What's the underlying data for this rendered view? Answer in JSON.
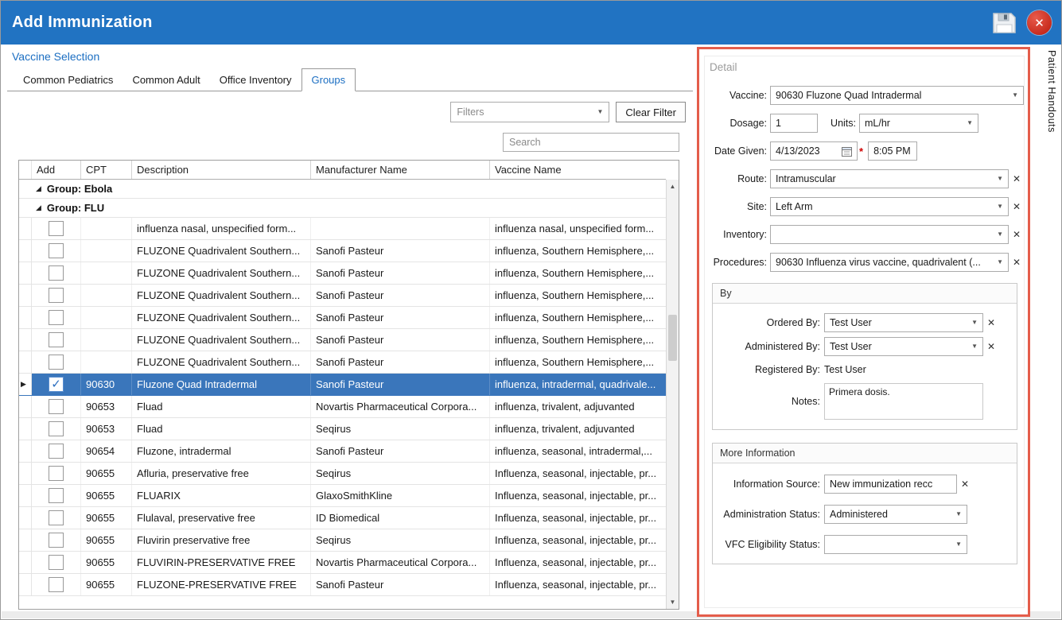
{
  "window": {
    "title": "Add Immunization"
  },
  "icons": {
    "dropdown": "▼",
    "clear": "✕",
    "close_window": "✕",
    "scroll_up": "▲",
    "scroll_down": "▼",
    "group_expander": "◢",
    "row_selector": "▶",
    "checkbox_check": "✓"
  },
  "side_tab_label": "Patient Handouts",
  "vaccine_selection": {
    "header": "Vaccine Selection",
    "tabs": [
      "Common Pediatrics",
      "Common Adult",
      "Office Inventory",
      "Groups"
    ],
    "active_tab": "Groups",
    "filters_placeholder": "Filters",
    "clear_filter_label": "Clear Filter",
    "search_placeholder": "Search",
    "grid": {
      "columns": [
        "Add",
        "CPT",
        "Description",
        "Manufacturer Name",
        "Vaccine Name"
      ],
      "groups": [
        {
          "label": "Group: Ebola",
          "rows": []
        },
        {
          "label": "Group: FLU",
          "rows": [
            {
              "checked": false,
              "selected": false,
              "cpt": "",
              "description": "influenza nasal, unspecified form...",
              "manufacturer": "",
              "vaccine_name": "influenza nasal, unspecified form..."
            },
            {
              "checked": false,
              "selected": false,
              "cpt": "",
              "description": "FLUZONE Quadrivalent Southern...",
              "manufacturer": "Sanofi Pasteur",
              "vaccine_name": "influenza, Southern Hemisphere,..."
            },
            {
              "checked": false,
              "selected": false,
              "cpt": "",
              "description": "FLUZONE Quadrivalent Southern...",
              "manufacturer": "Sanofi Pasteur",
              "vaccine_name": "influenza, Southern Hemisphere,..."
            },
            {
              "checked": false,
              "selected": false,
              "cpt": "",
              "description": "FLUZONE Quadrivalent Southern...",
              "manufacturer": "Sanofi Pasteur",
              "vaccine_name": "influenza, Southern Hemisphere,..."
            },
            {
              "checked": false,
              "selected": false,
              "cpt": "",
              "description": "FLUZONE Quadrivalent Southern...",
              "manufacturer": "Sanofi Pasteur",
              "vaccine_name": "influenza, Southern Hemisphere,..."
            },
            {
              "checked": false,
              "selected": false,
              "cpt": "",
              "description": "FLUZONE Quadrivalent Southern...",
              "manufacturer": "Sanofi Pasteur",
              "vaccine_name": "influenza, Southern Hemisphere,..."
            },
            {
              "checked": false,
              "selected": false,
              "cpt": "",
              "description": "FLUZONE Quadrivalent Southern...",
              "manufacturer": "Sanofi Pasteur",
              "vaccine_name": "influenza, Southern Hemisphere,..."
            },
            {
              "checked": true,
              "selected": true,
              "cpt": "90630",
              "description": "Fluzone Quad Intradermal",
              "manufacturer": "Sanofi Pasteur",
              "vaccine_name": "influenza, intradermal, quadrivale..."
            },
            {
              "checked": false,
              "selected": false,
              "cpt": "90653",
              "description": "Fluad",
              "manufacturer": "Novartis Pharmaceutical Corpora...",
              "vaccine_name": "influenza, trivalent, adjuvanted"
            },
            {
              "checked": false,
              "selected": false,
              "cpt": "90653",
              "description": "Fluad",
              "manufacturer": "Seqirus",
              "vaccine_name": "influenza, trivalent, adjuvanted"
            },
            {
              "checked": false,
              "selected": false,
              "cpt": "90654",
              "description": "Fluzone, intradermal",
              "manufacturer": "Sanofi Pasteur",
              "vaccine_name": "influenza, seasonal, intradermal,..."
            },
            {
              "checked": false,
              "selected": false,
              "cpt": "90655",
              "description": "Afluria, preservative free",
              "manufacturer": "Seqirus",
              "vaccine_name": "Influenza, seasonal, injectable, pr..."
            },
            {
              "checked": false,
              "selected": false,
              "cpt": "90655",
              "description": "FLUARIX",
              "manufacturer": "GlaxoSmithKline",
              "vaccine_name": "Influenza, seasonal, injectable, pr..."
            },
            {
              "checked": false,
              "selected": false,
              "cpt": "90655",
              "description": "Flulaval, preservative free",
              "manufacturer": "ID Biomedical",
              "vaccine_name": "Influenza, seasonal, injectable, pr..."
            },
            {
              "checked": false,
              "selected": false,
              "cpt": "90655",
              "description": "Fluvirin preservative free",
              "manufacturer": "Seqirus",
              "vaccine_name": "Influenza, seasonal, injectable, pr..."
            },
            {
              "checked": false,
              "selected": false,
              "cpt": "90655",
              "description": "FLUVIRIN-PRESERVATIVE FREE",
              "manufacturer": "Novartis Pharmaceutical Corpora...",
              "vaccine_name": "Influenza, seasonal, injectable, pr..."
            },
            {
              "checked": false,
              "selected": false,
              "cpt": "90655",
              "description": "FLUZONE-PRESERVATIVE FREE",
              "manufacturer": "Sanofi Pasteur",
              "vaccine_name": "Influenza, seasonal, injectable, pr..."
            }
          ]
        }
      ]
    }
  },
  "detail": {
    "header": "Detail",
    "vaccine_label": "Vaccine:",
    "vaccine_value": "90630 Fluzone Quad Intradermal",
    "dosage_label": "Dosage:",
    "dosage_value": "1",
    "units_label": "Units:",
    "units_value": "mL/hr",
    "date_given_label": "Date Given:",
    "date_value": "4/13/2023",
    "required_marker": "*",
    "time_value": "8:05 PM",
    "route_label": "Route:",
    "route_value": "Intramuscular",
    "site_label": "Site:",
    "site_value": "Left Arm",
    "inventory_label": "Inventory:",
    "inventory_value": "",
    "procedures_label": "Procedures:",
    "procedures_value": "90630 Influenza virus vaccine, quadrivalent (...",
    "by_group": {
      "header": "By",
      "ordered_by_label": "Ordered By:",
      "ordered_by_value": "Test User",
      "administered_by_label": "Administered By:",
      "administered_by_value": "Test User",
      "registered_by_label": "Registered By:",
      "registered_by_value": "Test User",
      "notes_label": "Notes:",
      "notes_value": "Primera dosis."
    },
    "more_info_group": {
      "header": "More Information",
      "information_source_label": "Information Source:",
      "information_source_value": "New immunization recc",
      "administration_status_label": "Administration Status:",
      "administration_status_value": "Administered",
      "vfc_label": "VFC Eligibility Status:",
      "vfc_value": ""
    }
  }
}
